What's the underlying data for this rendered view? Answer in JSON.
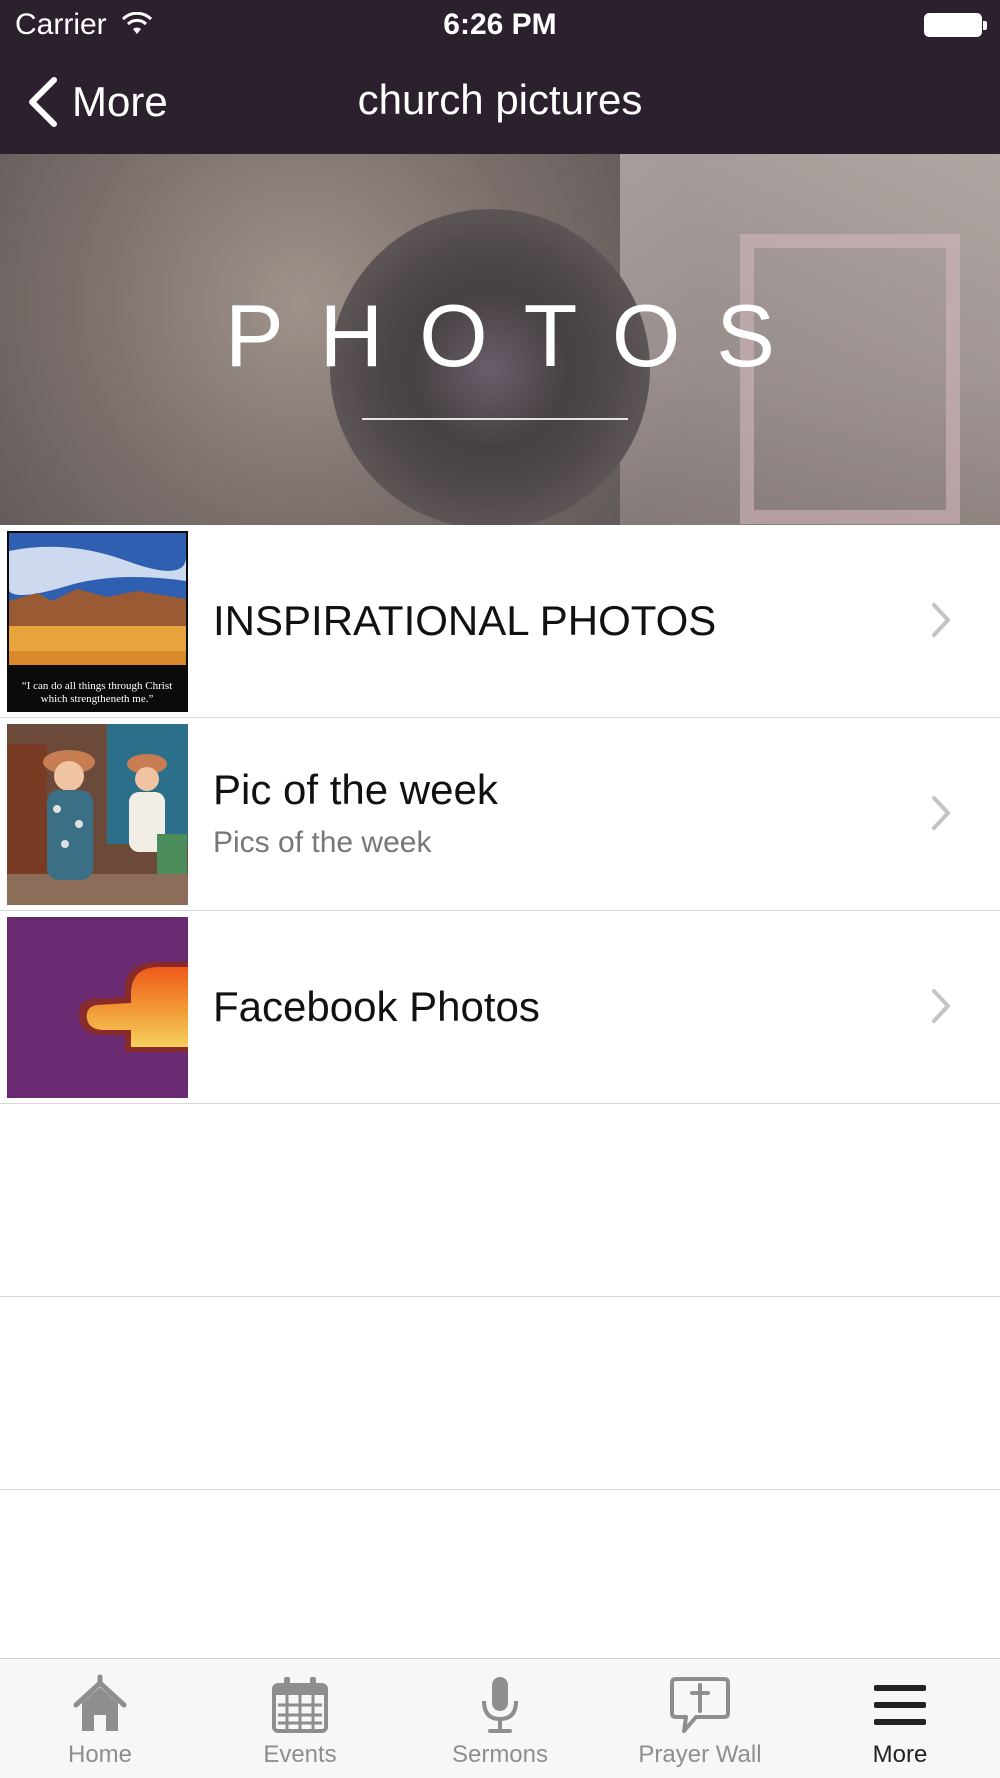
{
  "status_bar": {
    "carrier": "Carrier",
    "time": "6:26 PM"
  },
  "nav": {
    "back_label": "More",
    "title": "church pictures"
  },
  "banner": {
    "text": "PHOTOS"
  },
  "list": {
    "items": [
      {
        "title": "INSPIRATIONAL PHOTOS",
        "subtitle": "",
        "thumb_caption": "“I can do all things through Christ which strengtheneth me.”"
      },
      {
        "title": "Pic of the week",
        "subtitle": "Pics of the week"
      },
      {
        "title": "Facebook Photos",
        "subtitle": ""
      }
    ]
  },
  "tabbar": {
    "tabs": [
      {
        "label": "Home",
        "icon": "home-icon"
      },
      {
        "label": "Events",
        "icon": "calendar-icon"
      },
      {
        "label": "Sermons",
        "icon": "microphone-icon"
      },
      {
        "label": "Prayer Wall",
        "icon": "prayer-bubble-icon"
      },
      {
        "label": "More",
        "icon": "menu-icon"
      }
    ],
    "active": "More"
  },
  "colors": {
    "nav_bg": "#2c1f2e",
    "tab_inactive": "#8e8e8e",
    "tab_active": "#222222",
    "facebook_thumb_bg": "#6a2a72"
  }
}
